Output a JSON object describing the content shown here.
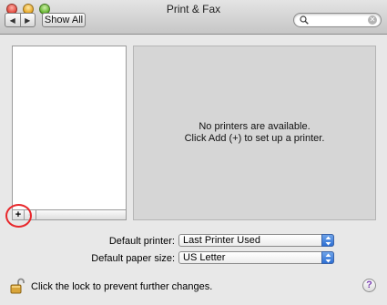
{
  "window": {
    "title": "Print & Fax"
  },
  "toolbar": {
    "back_icon": "back-arrow-icon",
    "forward_icon": "forward-arrow-icon",
    "show_all_label": "Show All",
    "search": {
      "value": "",
      "placeholder": ""
    }
  },
  "printer_list": {
    "items": [],
    "add_label": "+",
    "remove_label": "-"
  },
  "detail": {
    "message_line1": "No printers are available.",
    "message_line2": "Click Add (+) to set up a printer."
  },
  "defaults": {
    "printer_label": "Default printer:",
    "printer_value": "Last Printer Used",
    "paper_label": "Default paper size:",
    "paper_value": "US Letter"
  },
  "footer": {
    "lock_text": "Click the lock to prevent further changes.",
    "help_label": "?"
  },
  "colors": {
    "highlight_circle": "#e8272b",
    "popup_accent": "#2d6fd3"
  }
}
